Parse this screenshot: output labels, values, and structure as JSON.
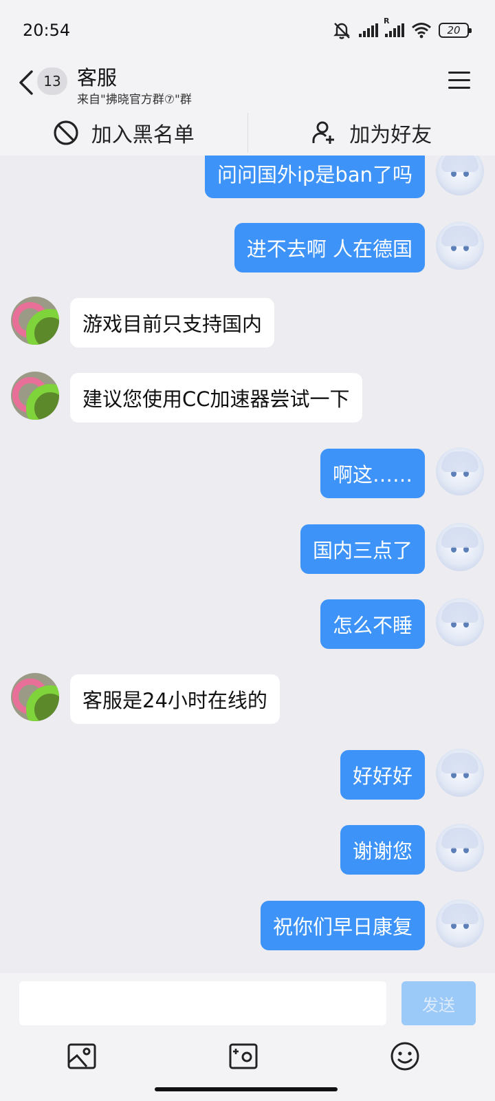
{
  "status_bar": {
    "time": "20:54",
    "signal2_label": "R",
    "battery": "20"
  },
  "header": {
    "unread_count": "13",
    "title": "客服",
    "subtitle": "来自\"拂晓官方群⑦\"群"
  },
  "actions": {
    "block_label": "加入黑名单",
    "add_friend_label": "加为好友"
  },
  "messages": [
    {
      "from": "me",
      "text": "问问国外ip是ban了吗"
    },
    {
      "from": "me",
      "text": "进不去啊 人在德国"
    },
    {
      "from": "other",
      "text": "游戏目前只支持国内"
    },
    {
      "from": "other",
      "text": "建议您使用CC加速器尝试一下"
    },
    {
      "from": "me",
      "text": "啊这……"
    },
    {
      "from": "me",
      "text": "国内三点了"
    },
    {
      "from": "me",
      "text": "怎么不睡"
    },
    {
      "from": "other",
      "text": "客服是24小时在线的"
    },
    {
      "from": "me",
      "text": "好好好"
    },
    {
      "from": "me",
      "text": "谢谢您"
    },
    {
      "from": "me",
      "text": "祝你们早日康复"
    }
  ],
  "composer": {
    "input_value": "",
    "send_label": "发送"
  },
  "colors": {
    "accent": "#3d93f7",
    "background": "#edecf1"
  }
}
